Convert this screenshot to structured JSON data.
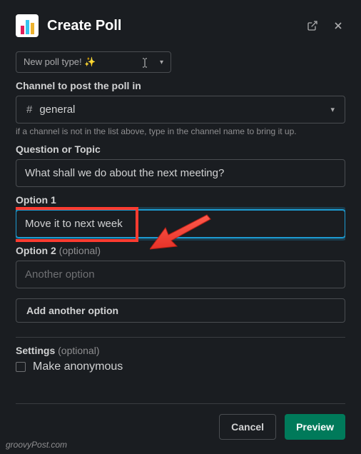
{
  "header": {
    "title": "Create Poll"
  },
  "poll_type": {
    "label": "New poll type! ✨"
  },
  "channel": {
    "label": "Channel to post the poll in",
    "hash": "#",
    "value": "general",
    "hint": "if a channel is not in the list above, type in the channel name to bring it up."
  },
  "question": {
    "label": "Question or Topic",
    "value": "What shall we do about the next meeting?"
  },
  "option1": {
    "label": "Option 1",
    "value": "Move it to next week"
  },
  "option2": {
    "label": "Option 2",
    "optional": "(optional)",
    "placeholder": "Another option"
  },
  "add_option": {
    "label": "Add another option"
  },
  "settings": {
    "label": "Settings",
    "optional": "(optional)",
    "anon": "Make anonymous"
  },
  "footer": {
    "cancel": "Cancel",
    "preview": "Preview"
  },
  "watermark": "groovyPost.com"
}
